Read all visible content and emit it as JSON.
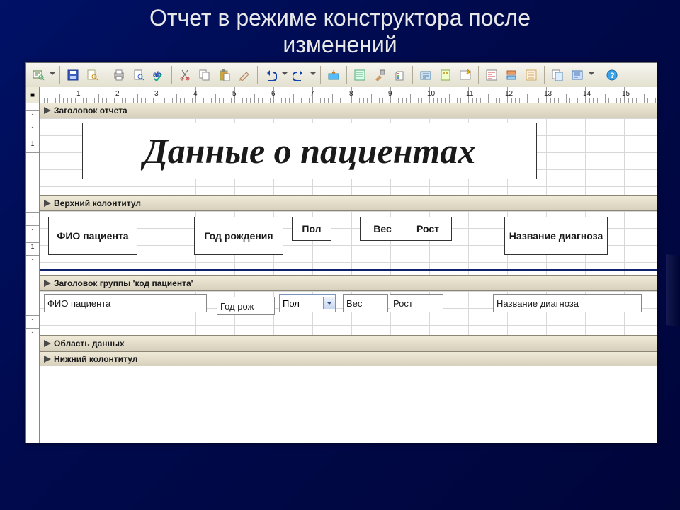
{
  "slide": {
    "title_line1": "Отчет в режиме конструктора после",
    "title_line2": "изменений"
  },
  "toolbar": {
    "icons": [
      "view",
      "save",
      "filesearch",
      "print",
      "preview",
      "spell",
      "cut",
      "copy",
      "paste",
      "format",
      "undo",
      "redo",
      "insert",
      "field",
      "tools",
      "code",
      "tab",
      "dbtool",
      "newobj",
      "props",
      "build",
      "wizard",
      "autoformat",
      "code2",
      "help"
    ]
  },
  "ruler": {
    "units_cm": [
      1,
      2,
      3,
      4,
      5,
      6,
      7,
      8,
      9,
      10,
      11,
      12,
      13,
      14,
      15
    ]
  },
  "sections": {
    "report_header": "Заголовок отчета",
    "page_header": "Верхний колонтитул",
    "group_header": "Заголовок группы 'код пациента'",
    "detail": "Область данных",
    "page_footer": "Нижний колонтитул"
  },
  "report_title": "Данные о пациентах",
  "column_labels": {
    "fio": "ФИО пациента",
    "year": "Год рождения",
    "sex": "Пол",
    "weight": "Вес",
    "height": "Рост",
    "diag": "Название диагноза"
  },
  "fields": {
    "fio": "ФИО пациента",
    "year": "Год рож",
    "sex": "Пол",
    "weight": "Вес",
    "height": "Рост",
    "diag": "Название диагноза"
  },
  "vruler_report": [
    "1"
  ],
  "vruler_page": [
    "1"
  ]
}
